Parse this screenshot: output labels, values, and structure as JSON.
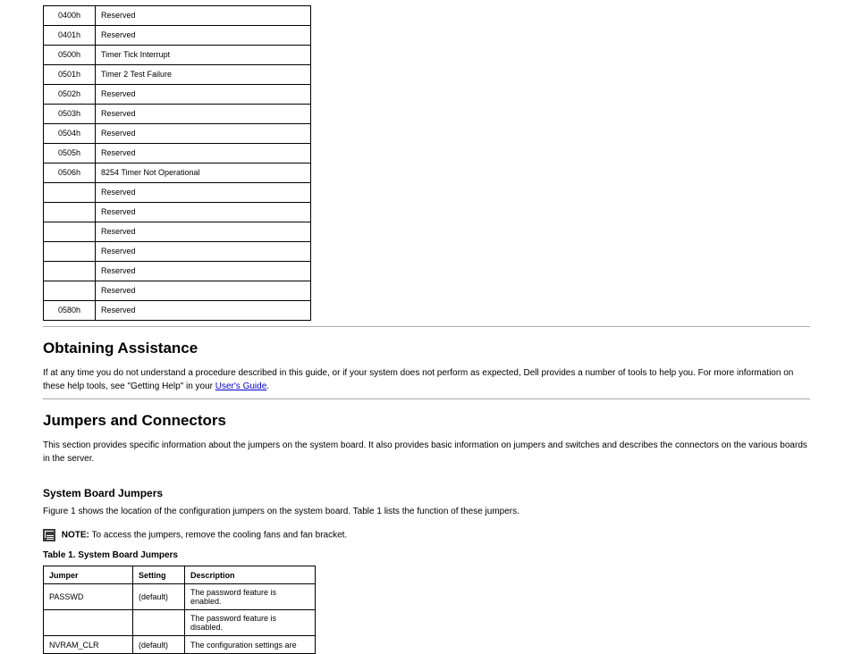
{
  "table1": {
    "rows": [
      {
        "code": "0400h",
        "desc": "Reserved"
      },
      {
        "code": "0401h",
        "desc": "Reserved"
      },
      {
        "code": "0500h",
        "desc": "Timer Tick Interrupt"
      },
      {
        "code": "0501h",
        "desc": "Timer 2 Test Failure"
      },
      {
        "code": "0502h",
        "desc": "Reserved"
      },
      {
        "code": "0503h",
        "desc": "Reserved"
      },
      {
        "code": "0504h",
        "desc": "Reserved"
      },
      {
        "code": "0505h",
        "desc": "Reserved"
      },
      {
        "code": "0506h",
        "desc": "8254 Timer Not Operational"
      },
      {
        "code": "",
        "desc": "Reserved"
      },
      {
        "code": "",
        "desc": "Reserved"
      },
      {
        "code": "",
        "desc": "Reserved"
      },
      {
        "code": "",
        "desc": "Reserved"
      },
      {
        "code": "",
        "desc": "Reserved"
      },
      {
        "code": "",
        "desc": "Reserved"
      },
      {
        "code": "0580h",
        "desc": "Reserved"
      }
    ]
  },
  "diag_section": {
    "heading": "Obtaining Assistance",
    "para_prefix": "If at any time you do not understand a procedure described in this guide, or if your system does not perform as expected, Dell provides a number of tools to help you. For more information on these help tools, see \"Getting Help\" in your ",
    "link_text": "User's Guide",
    "para_suffix": "."
  },
  "jumpers_section": {
    "heading": "Jumpers and Connectors",
    "intro": "This section provides specific information about the jumpers on the system board. It also provides basic information on jumpers and switches and describes the connectors on the various boards in the server.",
    "subheading": "System Board Jumpers",
    "subpara": "Figure 1 shows the location of the configuration jumpers on the system board. Table 1 lists the function of these jumpers.",
    "note_label": "NOTE:",
    "note_text": " To access the jumpers, remove the cooling fans and fan bracket.",
    "table_caption": "Table 1.  System Board Jumpers",
    "headers": [
      "Jumper",
      "Setting",
      "Description"
    ],
    "rows": [
      {
        "jumper": "PASSWD",
        "setting": "(default)",
        "desc": "The password feature is enabled."
      },
      {
        "jumper": "",
        "setting": "",
        "desc": "The password feature is disabled."
      },
      {
        "jumper": "NVRAM_CLR",
        "setting": "(default)",
        "desc": "The configuration settings are"
      }
    ]
  }
}
